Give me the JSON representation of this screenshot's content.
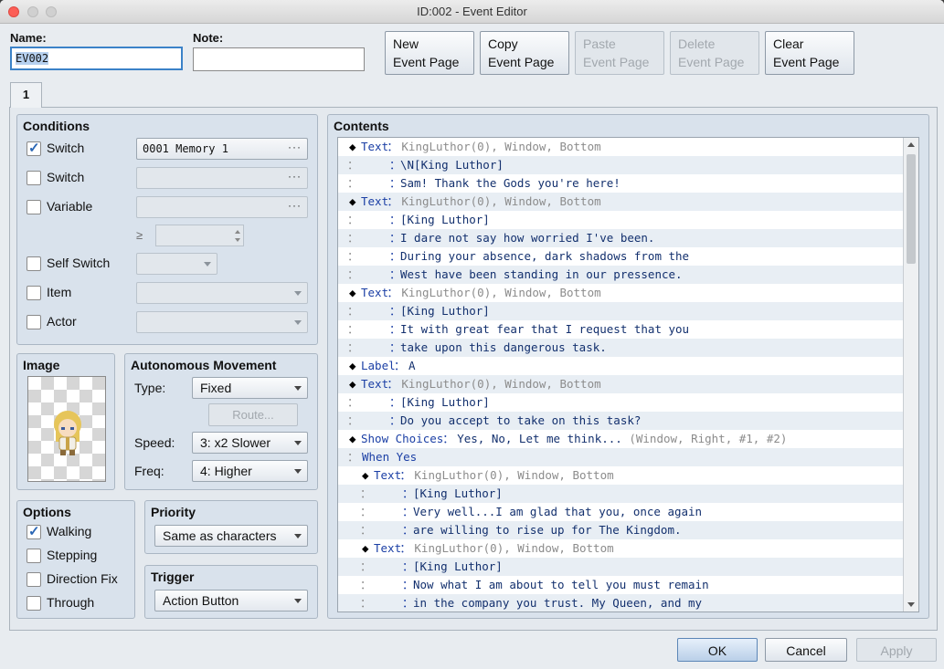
{
  "window": {
    "title": "ID:002 - Event Editor"
  },
  "header": {
    "name_label": "Name:",
    "name_value": "EV002",
    "note_label": "Note:",
    "note_value": ""
  },
  "toolbar": [
    {
      "line1": "New",
      "line2": "Event Page",
      "enabled": true
    },
    {
      "line1": "Copy",
      "line2": "Event Page",
      "enabled": true
    },
    {
      "line1": "Paste",
      "line2": "Event Page",
      "enabled": false
    },
    {
      "line1": "Delete",
      "line2": "Event Page",
      "enabled": false
    },
    {
      "line1": "Clear",
      "line2": "Event Page",
      "enabled": true
    }
  ],
  "page_tab": "1",
  "conditions": {
    "title": "Conditions",
    "switch1_label": "Switch",
    "switch1_checked": true,
    "switch1_value": "0001 Memory 1",
    "switch2_label": "Switch",
    "switch2_checked": false,
    "variable_label": "Variable",
    "variable_checked": false,
    "gte_symbol": "≥",
    "self_switch_label": "Self Switch",
    "self_switch_checked": false,
    "item_label": "Item",
    "item_checked": false,
    "actor_label": "Actor",
    "actor_checked": false,
    "dots": "···"
  },
  "image": {
    "title": "Image"
  },
  "movement": {
    "title": "Autonomous Movement",
    "type_label": "Type:",
    "type_value": "Fixed",
    "route_label": "Route...",
    "speed_label": "Speed:",
    "speed_value": "3: x2 Slower",
    "freq_label": "Freq:",
    "freq_value": "4: Higher"
  },
  "options": {
    "title": "Options",
    "walking_label": "Walking",
    "walking_checked": true,
    "stepping_label": "Stepping",
    "stepping_checked": false,
    "direction_fix_label": "Direction Fix",
    "direction_fix_checked": false,
    "through_label": "Through",
    "through_checked": false
  },
  "priority": {
    "title": "Priority",
    "value": "Same as characters"
  },
  "trigger": {
    "title": "Trigger",
    "value": "Action Button"
  },
  "contents": {
    "title": "Contents",
    "rows": [
      {
        "indent": 0,
        "kind": "cmd",
        "marker": "◆",
        "cmd": "Text",
        "sep": "：",
        "rest": "KingLuthor(0), Window, Bottom",
        "rest_style": "gray"
      },
      {
        "indent": 0,
        "kind": "cont",
        "marker": "：",
        "sep": "：",
        "rest": "\\N[King Luthor]",
        "rest_style": "blue"
      },
      {
        "indent": 0,
        "kind": "cont",
        "marker": "：",
        "sep": "：",
        "rest": "Sam! Thank the Gods you're here!",
        "rest_style": "blue"
      },
      {
        "indent": 0,
        "kind": "cmd",
        "marker": "◆",
        "cmd": "Text",
        "sep": "：",
        "rest": "KingLuthor(0), Window, Bottom",
        "rest_style": "gray"
      },
      {
        "indent": 0,
        "kind": "cont",
        "marker": "：",
        "sep": "：",
        "rest": "[King Luthor]",
        "rest_style": "blue"
      },
      {
        "indent": 0,
        "kind": "cont",
        "marker": "：",
        "sep": "：",
        "rest": "I dare not say how worried I've been.",
        "rest_style": "blue"
      },
      {
        "indent": 0,
        "kind": "cont",
        "marker": "：",
        "sep": "：",
        "rest": "During your absence, dark shadows from the",
        "rest_style": "blue"
      },
      {
        "indent": 0,
        "kind": "cont",
        "marker": "：",
        "sep": "：",
        "rest": "West have been standing in our pressence.",
        "rest_style": "blue"
      },
      {
        "indent": 0,
        "kind": "cmd",
        "marker": "◆",
        "cmd": "Text",
        "sep": "：",
        "rest": "KingLuthor(0), Window, Bottom",
        "rest_style": "gray"
      },
      {
        "indent": 0,
        "kind": "cont",
        "marker": "：",
        "sep": "：",
        "rest": "[King Luthor]",
        "rest_style": "blue"
      },
      {
        "indent": 0,
        "kind": "cont",
        "marker": "：",
        "sep": "：",
        "rest": "It with great fear that I request that you",
        "rest_style": "blue"
      },
      {
        "indent": 0,
        "kind": "cont",
        "marker": "：",
        "sep": "：",
        "rest": "take upon this dangerous task.",
        "rest_style": "blue"
      },
      {
        "indent": 0,
        "kind": "cmd",
        "marker": "◆",
        "cmd": "Label",
        "sep": "：",
        "rest": "A",
        "rest_style": "blue"
      },
      {
        "indent": 0,
        "kind": "cmd",
        "marker": "◆",
        "cmd": "Text",
        "sep": "：",
        "rest": "KingLuthor(0), Window, Bottom",
        "rest_style": "gray"
      },
      {
        "indent": 0,
        "kind": "cont",
        "marker": "：",
        "sep": "：",
        "rest": "[King Luthor]",
        "rest_style": "blue"
      },
      {
        "indent": 0,
        "kind": "cont",
        "marker": "：",
        "sep": "：",
        "rest": "Do you accept to take on this task?",
        "rest_style": "blue"
      },
      {
        "indent": 0,
        "kind": "cmd",
        "marker": "◆",
        "cmd": "Show Choices",
        "sep": "：",
        "rest": "Yes, No, Let me think...",
        "rest_style": "blue",
        "extra": " (Window, Right, #1, #2)"
      },
      {
        "indent": 0,
        "kind": "branch",
        "marker": "：",
        "rest": "When Yes"
      },
      {
        "indent": 1,
        "kind": "cmd",
        "marker": "◆",
        "cmd": "Text",
        "sep": "：",
        "rest": "KingLuthor(0), Window, Bottom",
        "rest_style": "gray"
      },
      {
        "indent": 1,
        "kind": "cont",
        "marker": "：",
        "sep": "：",
        "rest": "[King Luthor]",
        "rest_style": "blue"
      },
      {
        "indent": 1,
        "kind": "cont",
        "marker": "：",
        "sep": "：",
        "rest": "Very well...I am glad that you, once again",
        "rest_style": "blue"
      },
      {
        "indent": 1,
        "kind": "cont",
        "marker": "：",
        "sep": "：",
        "rest": "are willing to rise up for The Kingdom.",
        "rest_style": "blue"
      },
      {
        "indent": 1,
        "kind": "cmd",
        "marker": "◆",
        "cmd": "Text",
        "sep": "：",
        "rest": "KingLuthor(0), Window, Bottom",
        "rest_style": "gray"
      },
      {
        "indent": 1,
        "kind": "cont",
        "marker": "：",
        "sep": "：",
        "rest": "[King Luthor]",
        "rest_style": "blue"
      },
      {
        "indent": 1,
        "kind": "cont",
        "marker": "：",
        "sep": "：",
        "rest": "Now what I am about to tell you must remain",
        "rest_style": "blue"
      },
      {
        "indent": 1,
        "kind": "cont",
        "marker": "：",
        "sep": "：",
        "rest": "in the company you trust. My Queen, and my",
        "rest_style": "blue"
      }
    ]
  },
  "footer": {
    "ok": "OK",
    "cancel": "Cancel",
    "apply": "Apply"
  }
}
